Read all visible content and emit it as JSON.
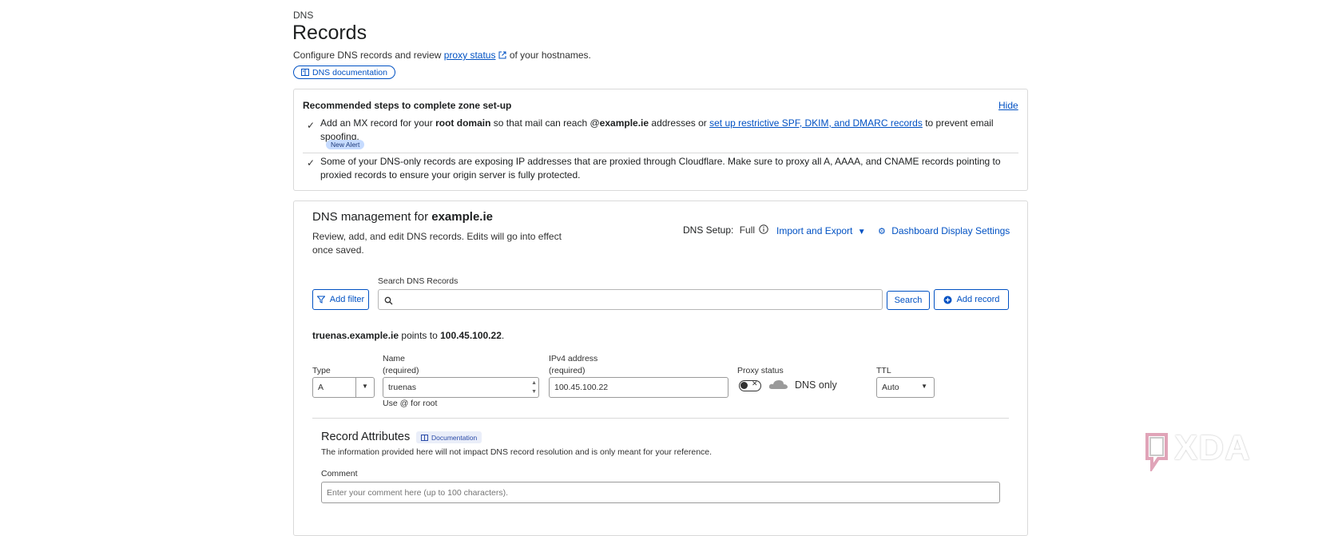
{
  "header": {
    "breadcrumb": "DNS",
    "title": "Records",
    "subtitle_prefix": "Configure DNS records and review",
    "subtitle_link": "proxy status",
    "subtitle_suffix": "of your hostnames.",
    "doc_button": "DNS documentation"
  },
  "recommended": {
    "title": "Recommended steps to complete zone set-up",
    "hide_label": "Hide",
    "step1": {
      "t1": "Add an MX record for your",
      "b1": "root domain",
      "t2": "so that mail can reach @",
      "b2": "example.ie",
      "t3": "addresses or",
      "link": "set up restrictive SPF, DKIM, and DMARC records",
      "t4": "to prevent email spoofing.",
      "badge": "New Alert"
    },
    "step2": {
      "text": "Some of your DNS-only records are exposing IP addresses that are proxied through Cloudflare. Make sure to proxy all A, AAAA, and CNAME records pointing to proxied records to ensure your origin server is fully protected."
    }
  },
  "management": {
    "title_prefix": "DNS management for",
    "domain": "example.ie",
    "description": "Review, add, and edit DNS records. Edits will go into effect once saved.",
    "setup_label": "DNS Setup:",
    "setup_value": "Full",
    "import_export": "Import and Export",
    "dashboard_settings": "Dashboard Display Settings",
    "search_label": "Search DNS Records",
    "search_placeholder": "",
    "add_filter": "Add filter",
    "search_button": "Search",
    "add_record": "Add record"
  },
  "record_form": {
    "points_host": "truenas.example.ie",
    "points_mid": "points to",
    "points_ip": "100.45.100.22",
    "type_label": "Type",
    "type_value": "A",
    "name_label": "Name",
    "name_required": "(required)",
    "name_value": "truenas",
    "name_hint": "Use @ for root",
    "ip_label": "IPv4 address",
    "ip_required": "(required)",
    "ip_value": "100.45.100.22",
    "proxy_label": "Proxy status",
    "proxy_value": "DNS only",
    "proxy_on": false,
    "ttl_label": "TTL",
    "ttl_value": "Auto"
  },
  "attributes": {
    "title": "Record Attributes",
    "doc_badge": "Documentation",
    "description": "The information provided here will not impact DNS record resolution and is only meant for your reference.",
    "comment_label": "Comment",
    "comment_placeholder": "Enter your comment here (up to 100 characters)."
  },
  "watermark": "XDA",
  "colors": {
    "link": "#0051c3",
    "badge_bg": "#c6dbff",
    "border": "#d9d9d9"
  }
}
